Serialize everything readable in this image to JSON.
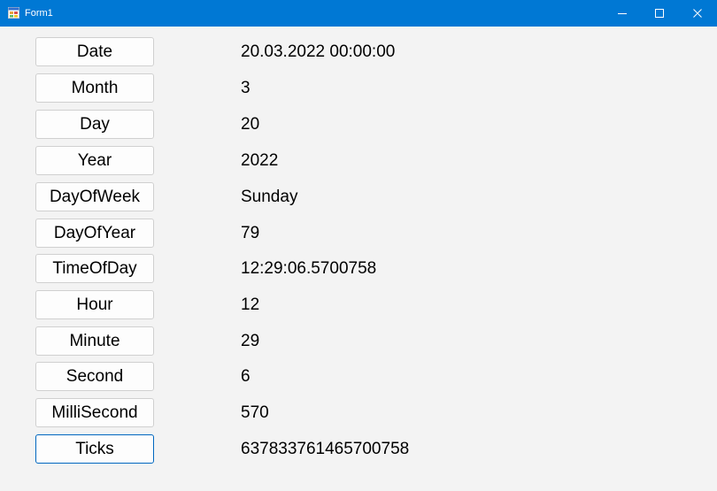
{
  "window": {
    "title": "Form1",
    "accent": "#0078d4",
    "controls": [
      "minimize-icon",
      "maximize-icon",
      "close-icon"
    ]
  },
  "rows": [
    {
      "label": "Date",
      "value": "20.03.2022 00:00:00"
    },
    {
      "label": "Month",
      "value": "3"
    },
    {
      "label": "Day",
      "value": "20"
    },
    {
      "label": "Year",
      "value": "2022"
    },
    {
      "label": "DayOfWeek",
      "value": "Sunday"
    },
    {
      "label": "DayOfYear",
      "value": "79"
    },
    {
      "label": "TimeOfDay",
      "value": "12:29:06.5700758"
    },
    {
      "label": "Hour",
      "value": "12"
    },
    {
      "label": "Minute",
      "value": "29"
    },
    {
      "label": "Second",
      "value": "6"
    },
    {
      "label": "MilliSecond",
      "value": "570"
    },
    {
      "label": "Ticks",
      "value": "637833761465700758",
      "focused": true
    }
  ]
}
